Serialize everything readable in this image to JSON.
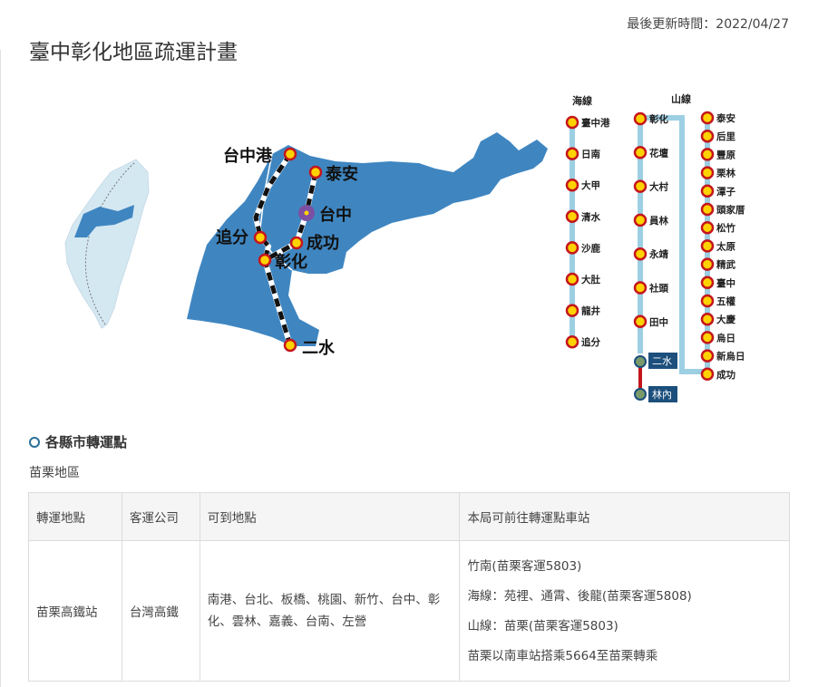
{
  "page": {
    "updated": "最後更新時間：2022/04/27",
    "title": "臺中彰化地區疏運計畫"
  },
  "map": {
    "stations": {
      "taichung_port": "台中港",
      "taian": "泰安",
      "taichung": "台中",
      "zhuifen": "追分",
      "chenggong": "成功",
      "changhua": "彰化",
      "ershui": "二水"
    },
    "colors": {
      "county": "#3f86c1",
      "taiwan": "#d4e8f2",
      "line": "#9dcfe3",
      "station_ring": "#c4161c",
      "station_fill": "#ffd200",
      "hub": "#7d4fa2",
      "badge": "#1c4f7c"
    }
  },
  "lines": {
    "sea_title": "海線",
    "mountain_title": "山線",
    "sea": [
      "臺中港",
      "日南",
      "大甲",
      "清水",
      "沙鹿",
      "大肚",
      "龍井",
      "追分"
    ],
    "mid": [
      "彰化",
      "花壇",
      "大村",
      "員林",
      "永靖",
      "社頭",
      "田中"
    ],
    "right": [
      "泰安",
      "后里",
      "豐原",
      "栗林",
      "潭子",
      "頭家厝",
      "松竹",
      "太原",
      "精武",
      "臺中",
      "五權",
      "大慶",
      "烏日",
      "新烏日",
      "成功"
    ],
    "ershui": "二水",
    "linnei": "林內"
  },
  "section": {
    "heading": "各縣市轉運點",
    "region": "苗栗地區"
  },
  "table": {
    "headers": [
      "轉運地點",
      "客運公司",
      "可到地點",
      "本局可前往轉運點車站"
    ],
    "row": {
      "location": "苗栗高鐵站",
      "company": "台灣高鐵",
      "destinations": "南港、台北、板橋、桃園、新竹、台中、彰化、雲林、嘉義、台南、左營",
      "stops": [
        "竹南(苗栗客運5803)",
        "海線：苑裡、通霄、後龍(苗栗客運5808)",
        "山線：苗栗(苗栗客運5803)",
        "苗栗以南車站搭乘5664至苗栗轉乘"
      ]
    }
  }
}
